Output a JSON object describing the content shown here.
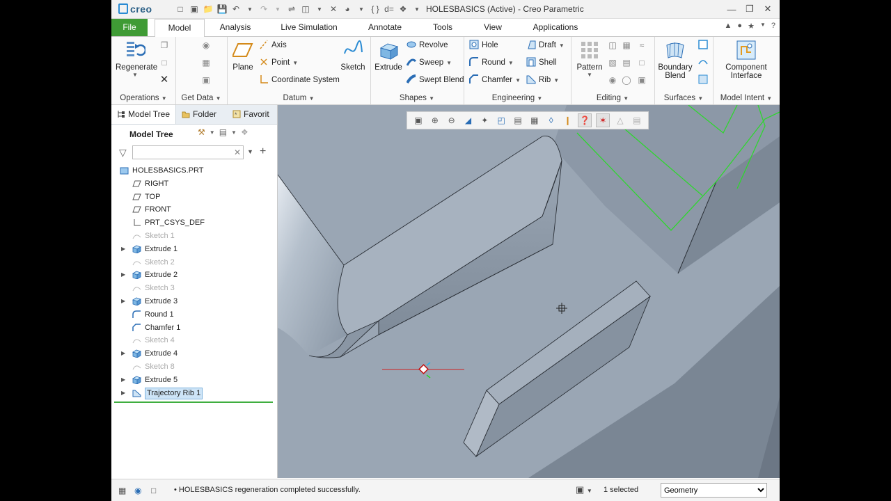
{
  "app": {
    "logo": "creo",
    "window_title": "HOLESBASICS (Active) - Creo Parametric"
  },
  "menu_tabs": [
    "File",
    "Model",
    "Analysis",
    "Live Simulation",
    "Annotate",
    "Tools",
    "View",
    "Applications"
  ],
  "ribbon": {
    "operations": {
      "label": "Operations",
      "regenerate": "Regenerate"
    },
    "get_data": {
      "label": "Get Data"
    },
    "datum": {
      "label": "Datum",
      "plane": "Plane",
      "axis": "Axis",
      "point": "Point",
      "csys": "Coordinate System",
      "sketch": "Sketch"
    },
    "shapes": {
      "label": "Shapes",
      "extrude": "Extrude",
      "revolve": "Revolve",
      "sweep": "Sweep",
      "swept_blend": "Swept Blend"
    },
    "engineering": {
      "label": "Engineering",
      "hole": "Hole",
      "round": "Round",
      "chamfer": "Chamfer",
      "draft": "Draft",
      "shell": "Shell",
      "rib": "Rib"
    },
    "editing": {
      "label": "Editing",
      "pattern": "Pattern"
    },
    "surfaces": {
      "label": "Surfaces",
      "boundary_blend_1": "Boundary",
      "boundary_blend_2": "Blend"
    },
    "model_intent": {
      "label": "Model Intent",
      "component_interface_1": "Component",
      "component_interface_2": "Interface"
    }
  },
  "panel": {
    "tabs": [
      "Model Tree",
      "Folder",
      "Favorit"
    ],
    "header": "Model Tree",
    "search_value": ""
  },
  "tree": [
    {
      "label": "HOLESBASICS.PRT",
      "icon": "part-icon",
      "level": 0,
      "expand": false,
      "dim": false,
      "selected": false
    },
    {
      "label": "RIGHT",
      "icon": "datum-plane-icon",
      "level": 1,
      "expand": false,
      "dim": false,
      "selected": false
    },
    {
      "label": "TOP",
      "icon": "datum-plane-icon",
      "level": 1,
      "expand": false,
      "dim": false,
      "selected": false
    },
    {
      "label": "FRONT",
      "icon": "datum-plane-icon",
      "level": 1,
      "expand": false,
      "dim": false,
      "selected": false
    },
    {
      "label": "PRT_CSYS_DEF",
      "icon": "csys-icon",
      "level": 1,
      "expand": false,
      "dim": false,
      "selected": false
    },
    {
      "label": "Sketch 1",
      "icon": "sketch-icon",
      "level": 1,
      "expand": false,
      "dim": true,
      "selected": false
    },
    {
      "label": "Extrude 1",
      "icon": "extrude-icon",
      "level": 1,
      "expand": true,
      "dim": false,
      "selected": false
    },
    {
      "label": "Sketch 2",
      "icon": "sketch-icon",
      "level": 1,
      "expand": false,
      "dim": true,
      "selected": false
    },
    {
      "label": "Extrude 2",
      "icon": "extrude-icon",
      "level": 1,
      "expand": true,
      "dim": false,
      "selected": false
    },
    {
      "label": "Sketch 3",
      "icon": "sketch-icon",
      "level": 1,
      "expand": false,
      "dim": true,
      "selected": false
    },
    {
      "label": "Extrude 3",
      "icon": "extrude-icon",
      "level": 1,
      "expand": true,
      "dim": false,
      "selected": false
    },
    {
      "label": "Round 1",
      "icon": "round-icon",
      "level": 1,
      "expand": false,
      "dim": false,
      "selected": false
    },
    {
      "label": "Chamfer 1",
      "icon": "chamfer-icon",
      "level": 1,
      "expand": false,
      "dim": false,
      "selected": false
    },
    {
      "label": "Sketch 4",
      "icon": "sketch-icon",
      "level": 1,
      "expand": false,
      "dim": true,
      "selected": false
    },
    {
      "label": "Extrude 4",
      "icon": "extrude-icon",
      "level": 1,
      "expand": true,
      "dim": false,
      "selected": false
    },
    {
      "label": "Sketch 8",
      "icon": "sketch-icon",
      "level": 1,
      "expand": false,
      "dim": true,
      "selected": false
    },
    {
      "label": "Extrude 5",
      "icon": "extrude-icon",
      "level": 1,
      "expand": true,
      "dim": false,
      "selected": false
    },
    {
      "label": "Trajectory Rib 1",
      "icon": "rib-icon",
      "level": 1,
      "expand": true,
      "dim": false,
      "selected": true
    }
  ],
  "status": {
    "message": "HOLESBASICS regeneration completed successfully.",
    "selection": "1 selected",
    "filter_value": "Geometry"
  },
  "colors": {
    "file_tab": "#3f9b35",
    "viewport_bg": "#9aa6b4",
    "selection_green": "#2fd62f",
    "tree_selection": "#cde4f7"
  }
}
